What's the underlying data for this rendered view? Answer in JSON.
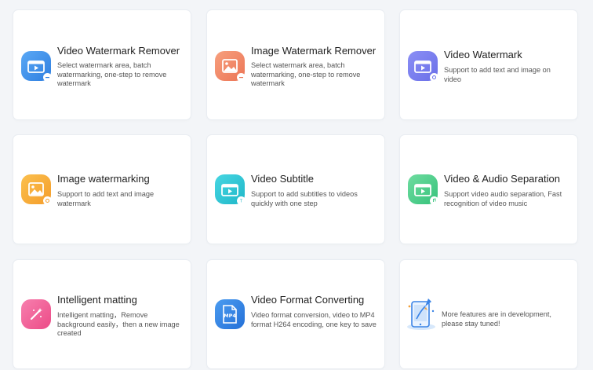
{
  "features": [
    {
      "title": "Video Watermark Remover",
      "desc": "Select watermark area, batch watermarking, one-step to remove watermark",
      "icon": "video-remove-icon",
      "color": "#3b8fe8"
    },
    {
      "title": "Image Watermark Remover",
      "desc": "Select watermark area, batch watermarking, one-step to remove watermark",
      "icon": "image-remove-icon",
      "color": "#f08a6a"
    },
    {
      "title": "Video Watermark",
      "desc": "Support to add text and image on video",
      "icon": "video-watermark-icon",
      "color": "#7b7ff0"
    },
    {
      "title": "Image watermarking",
      "desc": "Support to add text and image watermark",
      "icon": "image-watermark-icon",
      "color": "#f7ad3a"
    },
    {
      "title": "Video Subtitle",
      "desc": "Support to add subtitles to videos quickly with one step",
      "icon": "video-subtitle-icon",
      "color": "#2ec8d6"
    },
    {
      "title": "Video & Audio Separation",
      "desc": "Support video audio separation, Fast recognition of video music",
      "icon": "audio-separation-icon",
      "color": "#4ccf8a"
    },
    {
      "title": "Intelligent matting",
      "desc": "Intelligent matting，Remove background easily，then a new image created",
      "icon": "magic-wand-icon",
      "color": "#f2609a"
    },
    {
      "title": "Video Format Converting",
      "desc": "Video format conversion, video to MP4 format H264 encoding, one key to save",
      "icon": "mp4-file-icon",
      "color": "#2f86e8",
      "icon_text": "MP4"
    }
  ],
  "coming_soon": {
    "desc": "More features are in development, please stay tuned!",
    "icon": "phone-rocket-icon"
  }
}
